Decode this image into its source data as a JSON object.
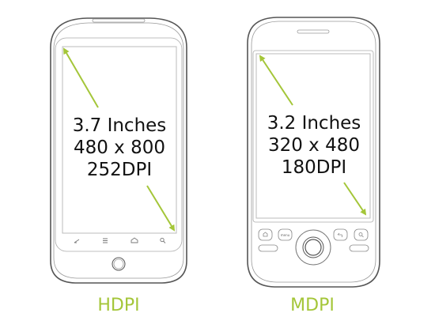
{
  "colors": {
    "accent": "#a4c639",
    "outline": "#555555"
  },
  "phones": [
    {
      "label": "HDPI",
      "size": "3.7 Inches",
      "resolution": "480 x 800",
      "density": "252DPI"
    },
    {
      "label": "MDPI",
      "size": "3.2 Inches",
      "resolution": "320 x 480",
      "density": "180DPI",
      "menu_key": "menu"
    }
  ]
}
